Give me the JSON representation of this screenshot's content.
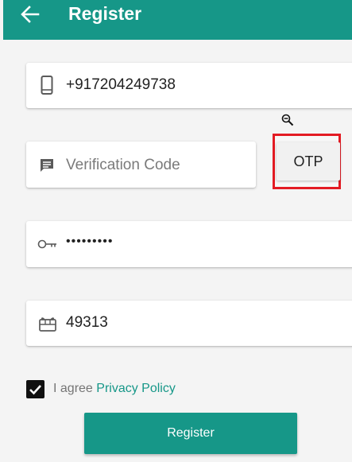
{
  "colors": {
    "primary": "#169788",
    "highlight_border": "#e31b23",
    "card": "#ffffff",
    "background": "#f4f4f4"
  },
  "appbar": {
    "title": "Register",
    "back_icon": "arrow-left-icon"
  },
  "form": {
    "phone": {
      "icon": "smartphone-icon",
      "value": "+917204249738"
    },
    "verification": {
      "icon": "message-icon",
      "placeholder": "Verification Code",
      "value": ""
    },
    "otp_button": "OTP",
    "password": {
      "icon": "key-icon",
      "value": "•••••••••"
    },
    "referral": {
      "icon": "gift-card-icon",
      "value": "49313"
    },
    "agree": {
      "checked": true,
      "text": "I agree",
      "link": "Privacy Policy"
    },
    "submit_label": "Register"
  },
  "overlay": {
    "icon": "zoom-out-icon"
  }
}
